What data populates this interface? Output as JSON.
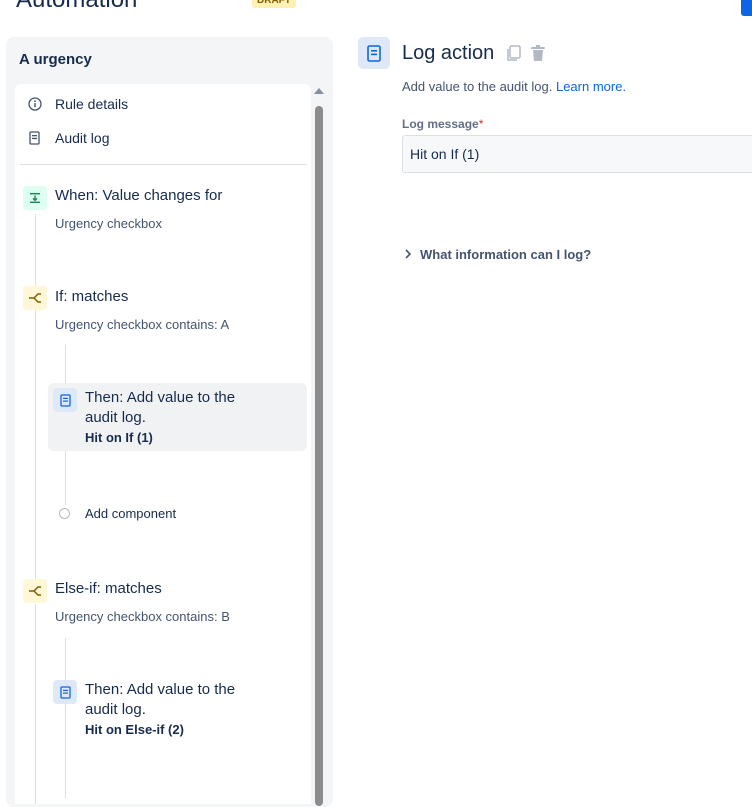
{
  "header": {
    "title": "Automation",
    "badge": "DRAFT"
  },
  "rule": {
    "name": "A urgency",
    "menu": [
      {
        "label": "Rule details",
        "icon": "info-icon"
      },
      {
        "label": "Audit log",
        "icon": "document-icon"
      }
    ],
    "components": [
      {
        "kind": "trigger",
        "icon": "trigger-icon",
        "title": "When: Value changes for",
        "subtitle": "Urgency checkbox"
      },
      {
        "kind": "condition",
        "icon": "branch-icon",
        "title": "If: matches",
        "subtitle": "Urgency checkbox contains: A"
      },
      {
        "kind": "action",
        "icon": "document-icon",
        "title_line1": "Then: Add value to the",
        "title_line2": "audit log.",
        "detail": "Hit on If (1)"
      },
      {
        "kind": "add",
        "label": "Add component"
      },
      {
        "kind": "condition",
        "icon": "branch-icon",
        "title": "Else-if: matches",
        "subtitle": "Urgency checkbox contains: B"
      },
      {
        "kind": "action",
        "icon": "document-icon",
        "title_line1": "Then: Add value to the",
        "title_line2": "audit log.",
        "detail": "Hit on Else-if (2)"
      }
    ]
  },
  "detail": {
    "title": "Log action",
    "description": "Add value to the audit log.",
    "learn_more": "Learn more.",
    "field_label": "Log message",
    "required_mark": "*",
    "field_value": "Hit on If (1)",
    "info_toggle": "What information can I log?"
  },
  "colors": {
    "link": "#0c66e4",
    "trigger_bg": "#dcfff1",
    "condition_bg": "#fff7d6",
    "action_bg": "#dfe8f7"
  }
}
